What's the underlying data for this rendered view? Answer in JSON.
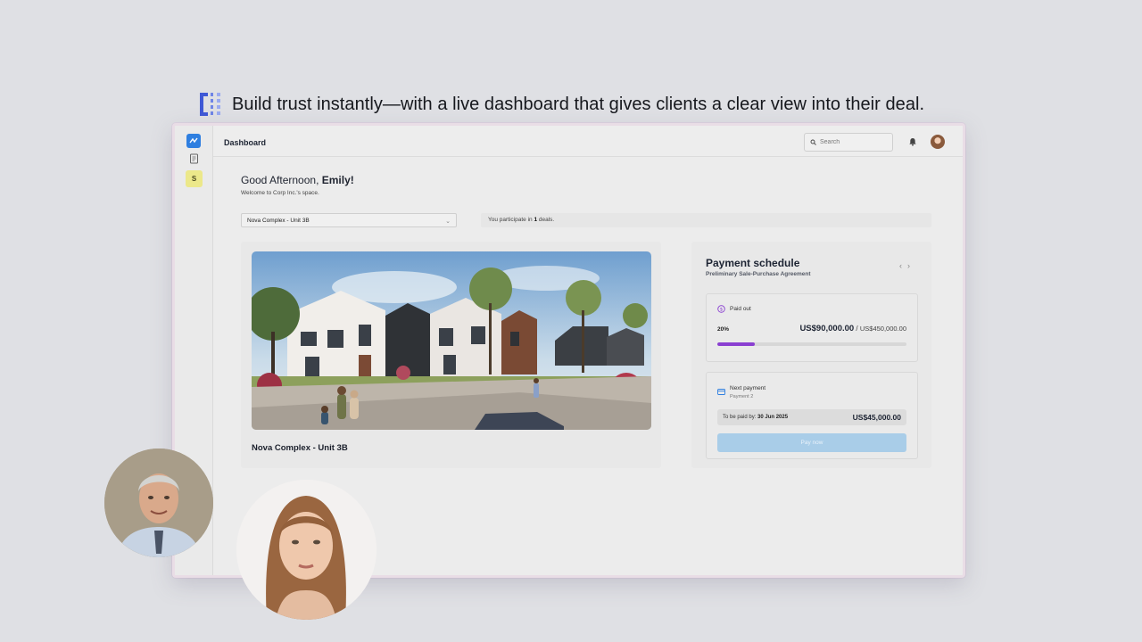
{
  "headline": {
    "text": "Build trust instantly—with a live dashboard that gives clients a clear view into their deal."
  },
  "app": {
    "sidebar": {
      "workspace_initial": "S"
    },
    "topbar": {
      "title": "Dashboard",
      "search_placeholder": "Search"
    },
    "greeting": {
      "prefix": "Good Afternoon, ",
      "name": "Emily!",
      "welcome": "Welcome to Corp Inc.'s space."
    },
    "unit_select": {
      "selected": "Nova Complex - Unit 3B"
    },
    "deals": {
      "prefix": "You participate in ",
      "count": "1",
      "suffix": " deals."
    },
    "property": {
      "name": "Nova Complex - Unit 3B"
    },
    "payment_schedule": {
      "title": "Payment schedule",
      "subtitle": "Preliminary Sale-Purchase Agreement",
      "prev": "‹",
      "next": "›",
      "paid_out": {
        "label": "Paid out",
        "percent_label": "20%",
        "progress_fraction": 0.2,
        "amount": "US$90,000.00",
        "separator": " / ",
        "total": "US$450,000.00"
      },
      "next_payment": {
        "label": "Next payment",
        "sub": "Payment 2",
        "due_prefix": "To be paid by: ",
        "due_date": "30 Jun 2025",
        "amount": "US$45,000.00",
        "button": "Pay now"
      }
    }
  },
  "colors": {
    "accent_blue": "#2f7fe0",
    "progress_purple": "#8a3fd1",
    "pay_button": "#a9cde8"
  }
}
